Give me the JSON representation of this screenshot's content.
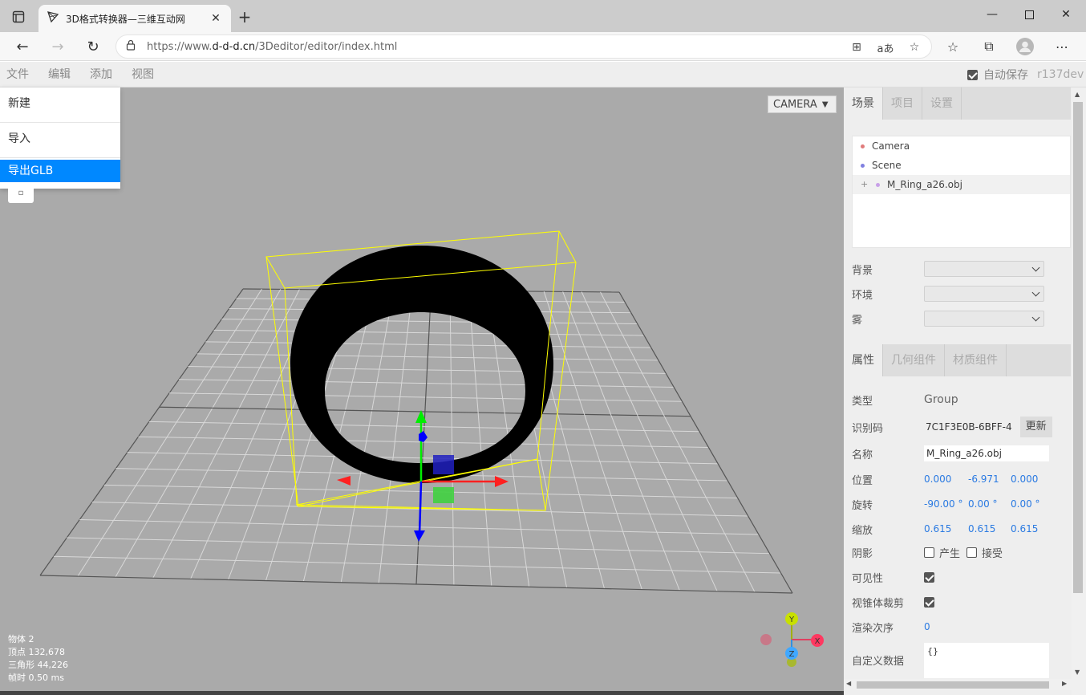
{
  "browser": {
    "tab_title": "3D格式转换器—三维互动网",
    "url_prefix": "https://www.",
    "url_domain": "d-d-d.cn",
    "url_path": "/3Deditor/editor/index.html"
  },
  "menubar": {
    "items": [
      "文件",
      "编辑",
      "添加",
      "视图"
    ],
    "autosave_label": "自动保存",
    "version": "r137dev"
  },
  "file_menu": {
    "items": [
      "新建",
      "导入",
      "导出GLB"
    ]
  },
  "viewport": {
    "camera_select": "CAMERA",
    "stats": {
      "objects": "物体  2",
      "vertices": "顶点  132,678",
      "triangles": "三角形  44,226",
      "frametime": "帧时  0.50 ms"
    },
    "gizmo_labels": {
      "y": "Y",
      "x": "X",
      "z": "Z"
    }
  },
  "sidebar": {
    "top_tabs": [
      "场景",
      "项目",
      "设置"
    ],
    "outliner": [
      {
        "label": "Camera",
        "color": "#e07b7b"
      },
      {
        "label": "Scene",
        "color": "#8080e0"
      },
      {
        "label": "M_Ring_a26.obj",
        "color": "#c8a0e8",
        "prefix": "+"
      }
    ],
    "scene_props": {
      "background_label": "背景",
      "environment_label": "环境",
      "fog_label": "雾"
    },
    "prop_tabs": [
      "属性",
      "几何组件",
      "材质组件"
    ],
    "object": {
      "type_label": "类型",
      "type_value": "Group",
      "uuid_label": "识别码",
      "uuid_value": "7C1F3E0B-6BFF-4",
      "update_button": "更新",
      "name_label": "名称",
      "name_value": "M_Ring_a26.obj",
      "position_label": "位置",
      "position": [
        "0.000",
        "-6.971",
        "0.000"
      ],
      "rotation_label": "旋转",
      "rotation": [
        "-90.00 °",
        "0.00 °",
        "0.00 °"
      ],
      "scale_label": "缩放",
      "scale": [
        "0.615",
        "0.615",
        "0.615"
      ],
      "shadow_label": "阴影",
      "cast_label": "产生",
      "receive_label": "接受",
      "visible_label": "可见性",
      "frustum_label": "视锥体裁剪",
      "render_order_label": "渲染次序",
      "render_order": "0",
      "userdata_label": "自定义数据",
      "userdata": "{}"
    }
  }
}
